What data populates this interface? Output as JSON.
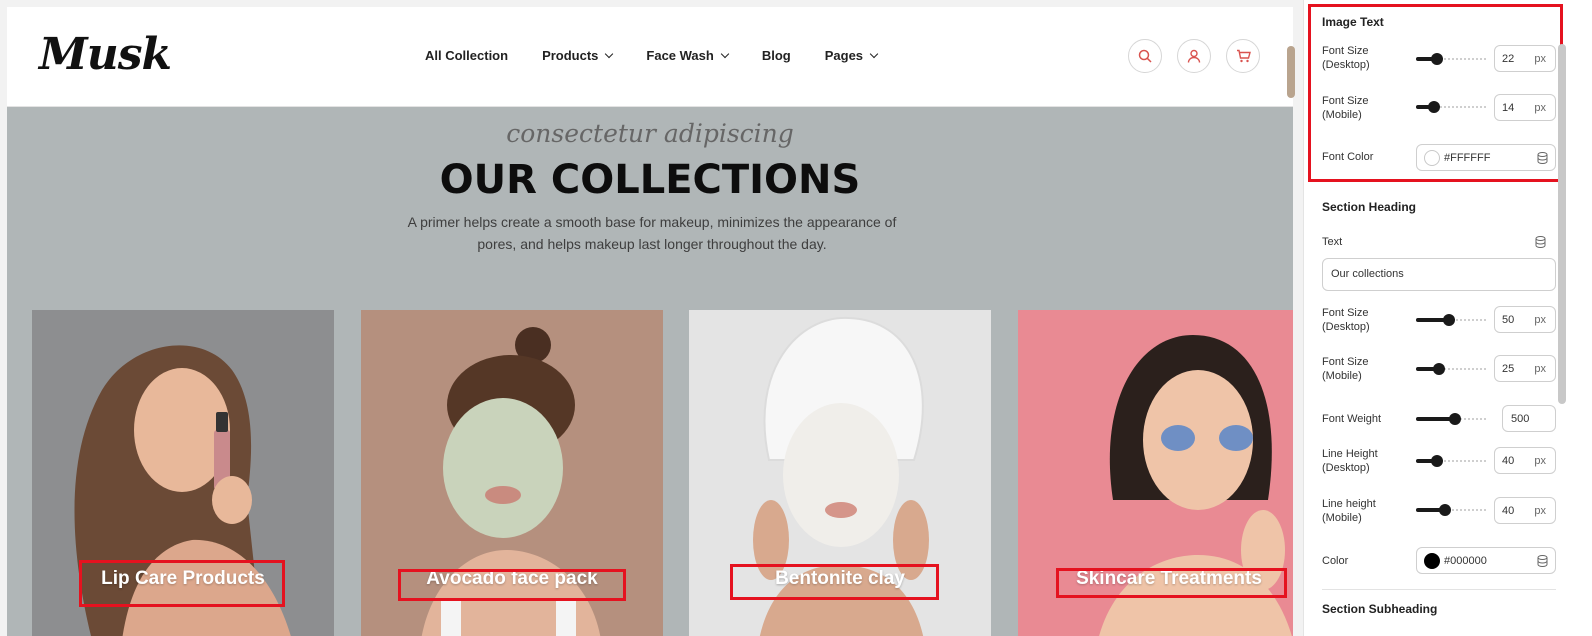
{
  "site": {
    "logo": "Musk",
    "nav": [
      {
        "label": "All Collection",
        "dropdown": false
      },
      {
        "label": "Products",
        "dropdown": true
      },
      {
        "label": "Face Wash",
        "dropdown": true
      },
      {
        "label": "Blog",
        "dropdown": false
      },
      {
        "label": "Pages",
        "dropdown": true
      }
    ],
    "header_icons": [
      "search-icon",
      "user-icon",
      "cart-icon"
    ]
  },
  "hero": {
    "subheading": "consectetur adipiscing",
    "heading": "OUR COLLECTIONS",
    "description": "A primer helps create a smooth base for makeup, minimizes the appearance of pores, and helps makeup last longer throughout the day."
  },
  "cards": [
    {
      "label": "Lip Care Products",
      "bg": "#8d8e90"
    },
    {
      "label": "Avocado face pack",
      "bg": "#b5907e"
    },
    {
      "label": "Bentonite clay",
      "bg": "#e4e4e4"
    },
    {
      "label": "Skincare Treatments",
      "bg": "#e98a93"
    }
  ],
  "panel": {
    "image_text": {
      "title": "Image Text",
      "font_size_desktop_label": "Font Size (Desktop)",
      "font_size_desktop": {
        "value": "22",
        "unit": "px",
        "level": 0.25
      },
      "font_size_mobile_label": "Font Size (Mobile)",
      "font_size_mobile": {
        "value": "14",
        "unit": "px",
        "level": 0.2
      },
      "font_color_label": "Font Color",
      "font_color": {
        "value": "#FFFFFF",
        "swatch": "#ffffff"
      }
    },
    "section_heading": {
      "title": "Section Heading",
      "text_label": "Text",
      "text_value": "Our collections",
      "font_size_desktop_label": "Font Size (Desktop)",
      "font_size_desktop": {
        "value": "50",
        "unit": "px",
        "level": 0.45
      },
      "font_size_mobile_label": "Font Size (Mobile)",
      "font_size_mobile": {
        "value": "25",
        "unit": "px",
        "level": 0.28
      },
      "font_weight_label": "Font Weight",
      "font_weight": {
        "value": "500",
        "level": 0.55
      },
      "line_height_desktop_label": "Line Height (Desktop)",
      "line_height_desktop": {
        "value": "40",
        "unit": "px",
        "level": 0.25
      },
      "line_height_mobile_label": "Line height (Mobile)",
      "line_height_mobile": {
        "value": "40",
        "unit": "px",
        "level": 0.38
      },
      "color_label": "Color",
      "color": {
        "value": "#000000",
        "swatch": "#000000"
      }
    },
    "section_subheading": {
      "title": "Section Subheading"
    }
  },
  "colors": {
    "highlight": "#e5121f",
    "accent": "#d9534f"
  }
}
